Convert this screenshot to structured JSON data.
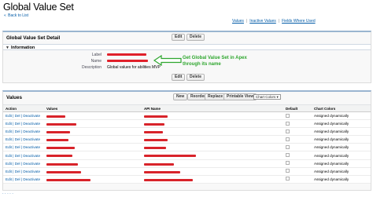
{
  "page": {
    "title": "Global Value Set",
    "back_link": "Back to List",
    "back_arrow": "«"
  },
  "top_links": [
    "Values",
    "Inactive Values",
    "Fields Where Used"
  ],
  "detail": {
    "title": "Global Value Set Detail",
    "edit_label": "Edit",
    "delete_label": "Delete",
    "section_title": "Information",
    "label_label": "Label",
    "name_label": "Name",
    "description_label": "Description",
    "description_value": "Global values for abilities MVP"
  },
  "annotation": {
    "line1": "Get Global Value Set in Apex",
    "line2": "through its name"
  },
  "values_section": {
    "title": "Values",
    "buttons": [
      "New",
      "Reorder",
      "Replace",
      "Printable View"
    ],
    "chart_colors_select": "Chart Colors",
    "columns": [
      "Action",
      "Values",
      "API Name",
      "Default",
      "Chart Colors"
    ],
    "row_action": {
      "edit": "Edit",
      "sep": "|",
      "del": "Del",
      "deactivate": "Deactivate"
    },
    "rows": [
      {
        "chart_color": "Assigned dynamically"
      },
      {
        "chart_color": "Assigned dynamically"
      },
      {
        "chart_color": "Assigned dynamically"
      },
      {
        "chart_color": "Assigned dynamically"
      },
      {
        "chart_color": "Assigned dynamically"
      },
      {
        "chart_color": "Assigned dynamically"
      },
      {
        "chart_color": "Assigned dynamically"
      },
      {
        "chart_color": "Assigned dynamically"
      },
      {
        "chart_color": "Assigned dynamically"
      }
    ]
  },
  "colors": {
    "link": "#015ba7",
    "redaction": "#e0202a",
    "annotation": "#2ea62e",
    "panel_border": "#9ab5d0"
  }
}
